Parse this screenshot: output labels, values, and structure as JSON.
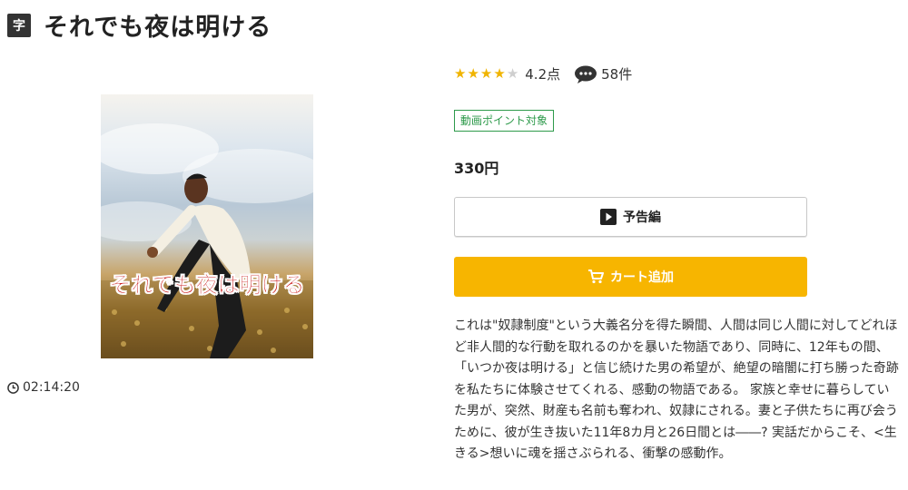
{
  "header": {
    "subtitle_badge": "字",
    "title": "それでも夜は明ける"
  },
  "poster": {
    "title_text": "それでも夜は明ける"
  },
  "runtime": "02:14:20",
  "rating": {
    "stars_filled": 4,
    "stars_total": 5,
    "score": "4.2点",
    "review_count": "58件"
  },
  "point_badge": "動画ポイント対象",
  "price": "330円",
  "buttons": {
    "trailer": "予告編",
    "cart": "カート追加"
  },
  "description": "これは\"奴隷制度\"という大義名分を得た瞬間、人間は同じ人間に対してどれほど非人間的な行動を取れるのかを暴いた物語であり、同時に、12年もの間、「いつか夜は明ける」と信じ続けた男の希望が、絶望の暗闇に打ち勝った奇跡を私たちに体験させてくれる、感動の物語である。 家族と幸せに暮らしていた男が、突然、財産も名前も奪われ、奴隷にされる。妻と子供たちに再び会うために、彼が生き抜いた11年8カ月と26日間とは――? 実話だからこそ、<生きる>想いに魂を揺さぶられる、衝撃の感動作。",
  "icons": {
    "comment": "speech-bubble-icon",
    "clock": "clock-icon",
    "play": "play-icon",
    "cart": "cart-icon"
  },
  "colors": {
    "star": "#f0b400",
    "cart_button": "#f7b500",
    "point_badge": "#2e9a4b",
    "poster_title": "#c81515"
  }
}
